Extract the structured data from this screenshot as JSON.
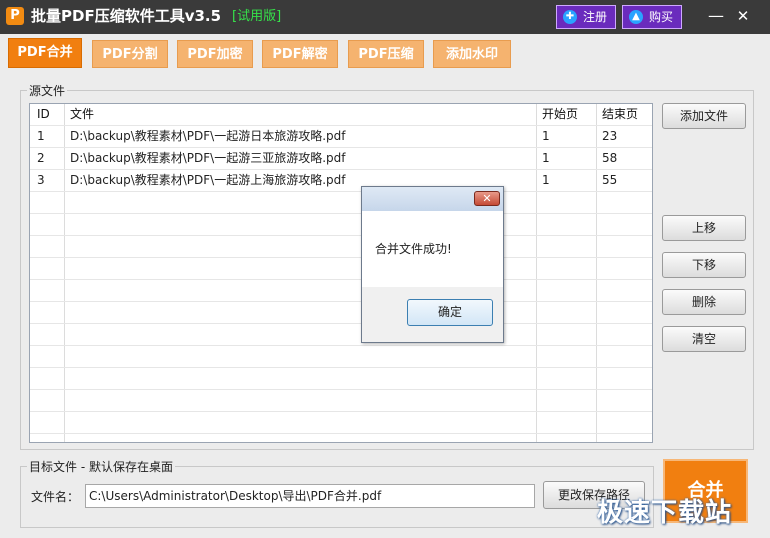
{
  "titlebar": {
    "title": "批量PDF压缩软件工具v3.5",
    "edition": "[试用版]",
    "register_label": "注册",
    "buy_label": "购买",
    "min_glyph": "—",
    "close_glyph": "✕"
  },
  "tabs": [
    {
      "label": "PDF合并",
      "active": true
    },
    {
      "label": "PDF分割"
    },
    {
      "label": "PDF加密"
    },
    {
      "label": "PDF解密"
    },
    {
      "label": "PDF压缩"
    },
    {
      "label": "添加水印"
    }
  ],
  "source": {
    "group_label": "源文件",
    "columns": [
      "ID",
      "文件",
      "开始页",
      "结束页"
    ],
    "rows": [
      {
        "id": "1",
        "file": "D:\\backup\\教程素材\\PDF\\一起游日本旅游攻略.pdf",
        "start": "1",
        "end": "23"
      },
      {
        "id": "2",
        "file": "D:\\backup\\教程素材\\PDF\\一起游三亚旅游攻略.pdf",
        "start": "1",
        "end": "58"
      },
      {
        "id": "3",
        "file": "D:\\backup\\教程素材\\PDF\\一起游上海旅游攻略.pdf",
        "start": "1",
        "end": "55"
      }
    ]
  },
  "side_buttons": {
    "add_file": "添加文件",
    "move_up": "上移",
    "move_down": "下移",
    "delete": "删除",
    "clear": "清空"
  },
  "dialog": {
    "message": "合并文件成功!",
    "ok_label": "确定",
    "close_glyph": "✕"
  },
  "target": {
    "group_label": "目标文件 - 默认保存在桌面",
    "filename_label": "文件名：",
    "filename_value": "C:\\Users\\Administrator\\Desktop\\导出\\PDF合并.pdf",
    "change_path_label": "更改保存路径"
  },
  "merge_label": "合并",
  "watermark": "极速下载站",
  "colors": {
    "accent": "#f17f10",
    "tab_inactive": "#f5b36f",
    "titlebar": "#3a3a3a",
    "edition": "#36e24a",
    "purple_button": "#6a2bbd"
  }
}
